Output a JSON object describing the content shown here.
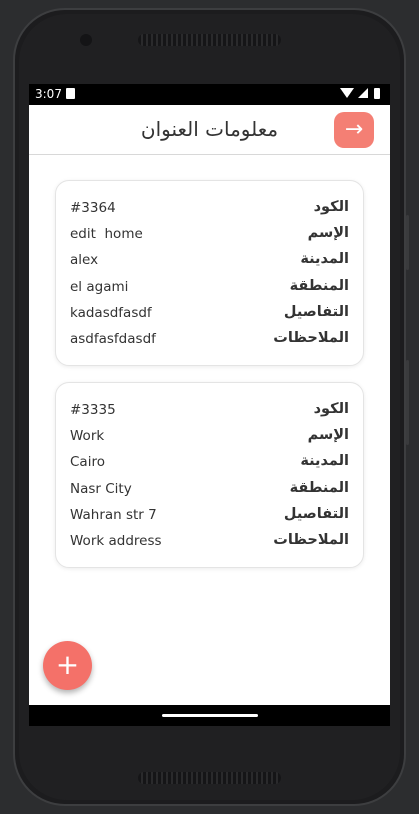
{
  "status_bar": {
    "time": "3:07"
  },
  "app_bar": {
    "title": "معلومات العنوان",
    "back_icon": "arrow-right-icon"
  },
  "addresses": [
    {
      "code": {
        "label": "الكود",
        "value": "#3364"
      },
      "name": {
        "label": "الإسم",
        "value": "edit  home"
      },
      "city": {
        "label": "المدينة",
        "value": "alex"
      },
      "area": {
        "label": "المنطقة",
        "value": "el agami"
      },
      "details": {
        "label": "التفاصيل",
        "value": "kadasdfasdf"
      },
      "notes": {
        "label": "الملاحظات",
        "value": "asdfasfdasdf"
      }
    },
    {
      "code": {
        "label": "الكود",
        "value": "#3335"
      },
      "name": {
        "label": "الإسم",
        "value": "Work"
      },
      "city": {
        "label": "المدينة",
        "value": "Cairo"
      },
      "area": {
        "label": "المنطقة",
        "value": "Nasr City"
      },
      "details": {
        "label": "التفاصيل",
        "value": "Wahran str 7"
      },
      "notes": {
        "label": "الملاحظات",
        "value": "Work address"
      }
    }
  ],
  "fab": {
    "icon": "plus-icon",
    "label": "+"
  },
  "colors": {
    "accent": "#f47f74",
    "fab": "#f47169"
  }
}
